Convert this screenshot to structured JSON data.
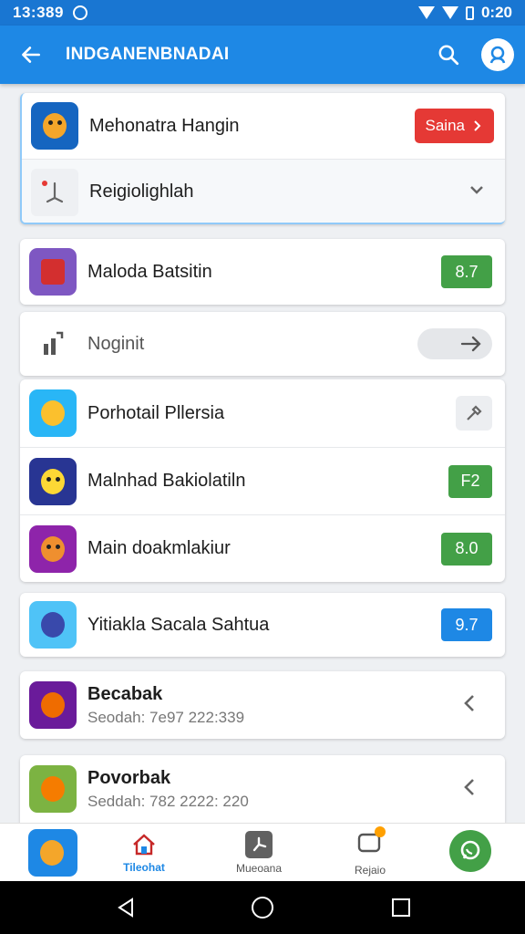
{
  "status_bar": {
    "time": "13:389",
    "battery_text": "0:20"
  },
  "app_bar": {
    "title": "INDGANENBNADAI"
  },
  "cards": {
    "card1": {
      "row1": {
        "label": "Mehonatra Hangin",
        "button": "Saina"
      },
      "row2": {
        "label": "Reigiolighlah"
      }
    },
    "card2": {
      "label": "Maloda Batsitin",
      "score": "8.7"
    },
    "card3": {
      "label": "Noginit"
    },
    "card4": {
      "row1": {
        "label": "Porhotail Pllersia"
      },
      "row2": {
        "label": "Malnhad Bakiolatiln",
        "score": "F2"
      },
      "row3": {
        "label": "Main doakmlakiur",
        "score": "8.0"
      }
    },
    "card5": {
      "label": "Yitiakla Sacala Sahtua",
      "score": "9.7"
    },
    "card6": {
      "title": "Becabak",
      "subtitle": "Seodah: 7e97 222:339"
    },
    "card7": {
      "title": "Povorbak",
      "subtitle": "Seddah: 782 2222: 220"
    }
  },
  "bottom_nav": {
    "home": "Tileohat",
    "mid": "Mueoana",
    "right": "Rejaio"
  },
  "colors": {
    "app_bar": "#1e88e5",
    "status_bar": "#1976d2",
    "accent_red": "#e53935",
    "accent_green": "#43a047",
    "accent_blue": "#1e88e5"
  },
  "icons": [
    "back-arrow-icon",
    "search-icon",
    "profile-icon",
    "chevron-right-icon",
    "chevron-down-icon",
    "map-pin-icon",
    "stats-icon",
    "arrow-right-icon",
    "wrench-icon",
    "chevron-left-icon",
    "home-icon",
    "fan-icon",
    "chat-bubble-icon",
    "whatsapp-icon"
  ]
}
